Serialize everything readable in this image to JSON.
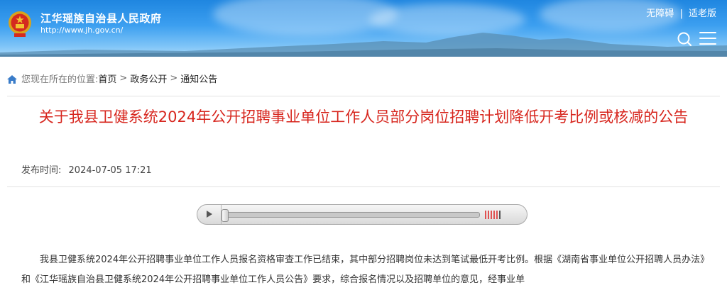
{
  "header": {
    "site_title": "江华瑶族自治县人民政府",
    "site_url": "http://www.jh.gov.cn/",
    "accessibility_link": "无障碍",
    "separator": "|",
    "elderly_link": "适老版",
    "search_icon": "search-icon",
    "menu_icon": "menu-icon"
  },
  "breadcrumb": {
    "prefix": "您现在所在的位置:",
    "items": [
      "首页",
      "政务公开",
      "通知公告"
    ],
    "separator": ">"
  },
  "article": {
    "title": "关于我县卫健系统2024年公开招聘事业单位工作人员部分岗位招聘计划降低开考比例或核减的公告",
    "publish_label": "发布时间:",
    "publish_time": "2024-07-05 17:21",
    "body_text": "我县卫健系统2024年公开招聘事业单位工作人员报名资格审查工作已结束，其中部分招聘岗位未达到笔试最低开考比例。根据《湖南省事业单位公开招聘人员办法》和《江华瑶族自治县卫健系统2024年公开招聘事业单位工作人员公告》要求，综合报名情况以及招聘单位的意见，经事业单"
  },
  "player": {
    "play_icon": "play-icon",
    "progress": 0
  },
  "colors": {
    "header_blue": "#2b8fe6",
    "title_red": "#d7261e"
  }
}
